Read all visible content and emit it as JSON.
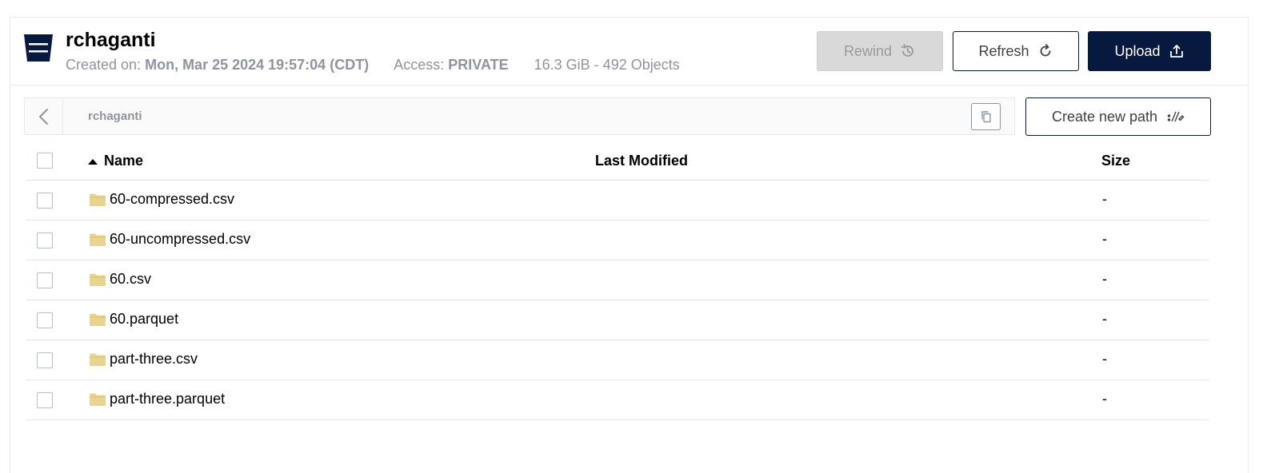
{
  "bucket": {
    "name": "rchaganti",
    "created_label": "Created on:",
    "created_value": "Mon, Mar 25 2024 19:57:04 (CDT)",
    "access_label": "Access:",
    "access_value": "PRIVATE",
    "usage": "16.3 GiB - 492 Objects"
  },
  "toolbar": {
    "rewind_label": "Rewind",
    "refresh_label": "Refresh",
    "upload_label": "Upload",
    "create_path_label": "Create new path"
  },
  "path": {
    "current": "rchaganti"
  },
  "table": {
    "columns": [
      "Name",
      "Last Modified",
      "Size"
    ],
    "sort_column": "Name",
    "sort_direction": "ascending",
    "rows": [
      {
        "name": "60-compressed.csv",
        "last_modified": "",
        "size": "-"
      },
      {
        "name": "60-uncompressed.csv",
        "last_modified": "",
        "size": "-"
      },
      {
        "name": "60.csv",
        "last_modified": "",
        "size": "-"
      },
      {
        "name": "60.parquet",
        "last_modified": "",
        "size": "-"
      },
      {
        "name": "part-three.csv",
        "last_modified": "",
        "size": "-"
      },
      {
        "name": "part-three.parquet",
        "last_modified": "",
        "size": "-"
      }
    ]
  },
  "icons": {
    "bucket": "bucket-icon",
    "rewind": "history-icon",
    "refresh": "refresh-icon",
    "upload": "upload-icon",
    "back": "chevron-left-icon",
    "copy": "copy-icon",
    "new_path": "new-path-icon",
    "sort": "sort-ascending-icon",
    "folder": "folder-icon"
  },
  "colors": {
    "brand_navy": "#07193e",
    "muted_text": "#8e959f",
    "disabled_button": "#d9d9d9",
    "folder": "#e8d48f"
  }
}
